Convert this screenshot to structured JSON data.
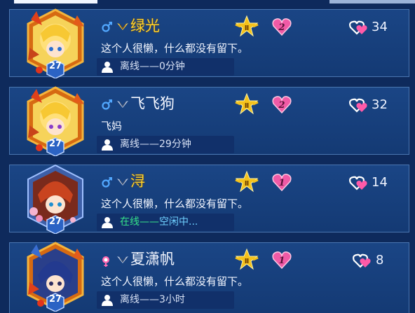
{
  "friends": [
    {
      "name": "绿光",
      "vip": true,
      "gender": "male",
      "rank_level": 2,
      "likes": "34",
      "level": "27",
      "signature": "这个人很懒，什么都没有留下。",
      "status": "离线——0分钟",
      "online": false
    },
    {
      "name": "飞飞狗",
      "vip": false,
      "gender": "male",
      "rank_level": 2,
      "likes": "32",
      "level": "27",
      "signature": "飞妈",
      "status": "离线——29分钟",
      "online": false
    },
    {
      "name": "浔",
      "vip": true,
      "gender": "male",
      "rank_level": 1,
      "likes": "14",
      "level": "27",
      "signature": "这个人很懒，什么都没有留下。",
      "status_prefix": "在线——",
      "status_idle": "空闲中...",
      "status": "在线——空闲中...",
      "online": true
    },
    {
      "name": "夏潇帆",
      "vip": false,
      "gender": "female",
      "rank_level": 1,
      "likes": "8",
      "level": "27",
      "signature": "这个人很懒，什么都没有留下。",
      "status": "离线——3小时",
      "online": false
    }
  ],
  "icons": {
    "male": "male-icon",
    "female": "female-icon",
    "wings": "wings-icon",
    "rank": "star-rank-icon",
    "heart_level": "heart-level-icon",
    "likes": "likes-hearts-icon",
    "person": "person-icon"
  },
  "colors": {
    "vip_name": "#ffd32a",
    "online": "#36e38a",
    "idle": "#6fd0ff",
    "card_bg": "#1a4585"
  }
}
